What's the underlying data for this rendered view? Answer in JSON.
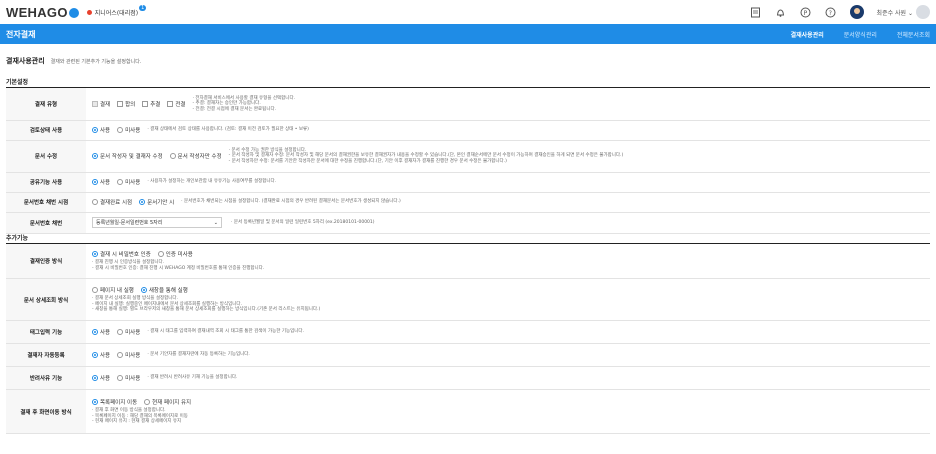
{
  "app": {
    "logo_text": "WEHAGO",
    "org_name": "지니어스(대리점)",
    "org_badge": "1",
    "user_name": "최준수 사원 ⌄"
  },
  "icons": {
    "top": [
      "document-icon",
      "bell-icon",
      "p-circle-icon",
      "help-icon"
    ]
  },
  "nav": {
    "title": "전자결재",
    "menu": [
      "결재사용관리",
      "문서양식관리",
      "전체문서조회"
    ]
  },
  "page": {
    "title": "결재사용관리",
    "desc": "결재와 관련된 기본추가 기능을 설정합니다."
  },
  "sections": {
    "basic": "기본설정",
    "extra": "추가기능"
  },
  "rows": {
    "type": {
      "label": "결재 유형",
      "opts": [
        "결재",
        "합의",
        "추결",
        "전결"
      ],
      "notes": [
        "· 전자결재 서비스에서 사용할 결재 유형을 선택합니다.",
        "  - 추결: 결재자는 승인만 가능합니다.",
        "  - 전결: 전결 시점에 결재 문서는 완료됩니다."
      ]
    },
    "review": {
      "label": "검토상태 사용",
      "opts": [
        "사용",
        "미사용"
      ],
      "note": "· 결재 상태에서 검토 상태를 사용합니다. (검토: 결재 이전 검토가 필요한 상태 • 보류)"
    },
    "modify": {
      "label": "문서 수정",
      "opts": [
        "문서 작성자 및 결재자 수정",
        "문서 작성자만 수정"
      ],
      "notes": [
        "· 문서 수정 가능 권한 방식을 설정합니다.",
        "  - 문서 작성자 및 결재자 수정: 문서 작성자 및 해당 문서의 결재권한을 보유한 결재권자가 내용을 수정할 수 있습니다.(단, 본인 결재순서에만 문서 수정이 가능하며 결재승인을 하게 되면 문서 수정은 불가합니다.)",
        "  - 문서 작성자만 수정: 문서를 기안한 작성자만 문서에 대한 수정을 진행합니다.(단, 기안 이후 결재자가 결재를 진행한 경우 문서 수정은 불가합니다.)"
      ]
    },
    "share": {
      "label": "공유기능 사용",
      "opts": [
        "사용",
        "미사용"
      ],
      "note": "· 사용자가 설정하는 개인보관함 내 유유기능 사용여부를 설정합니다."
    },
    "numtime": {
      "label": "문서번호 채번 시점",
      "opts": [
        "결재완료 시점",
        "문서기안 시"
      ],
      "note": "· 문서번호가 채번되는 시점을 설정합니다. (결재완료 시점의 경우 반려된 결재문서는 문서번호가 생성되지 않습니다.)"
    },
    "numrule": {
      "label": "문서번호 채번",
      "select": "등록년월일-문서일련번호 5자리",
      "note": "· 문서 등록년월일 및 문서의 일련 일련번호 5자리 (ex.20180101-00001)"
    },
    "auth": {
      "label": "결재인증 방식",
      "opts": [
        "결재 시 비밀번호 인증",
        "인증 미사용"
      ],
      "notes": [
        "· 결재 진행 시 인증방식을 설정합니다.",
        "  - 결재 시 비밀번호 인증: 결재 진행 시 WEHAGO 계정 비밀번호를 통해 인증을 진행합니다."
      ]
    },
    "detail": {
      "label": "문서 상세조회 방식",
      "opts": [
        "페이지 내 실행",
        "새창을 통해 실행"
      ],
      "notes": [
        "· 결재 문서 상세조회 실행 방식을 설정합니다.",
        "  - 페이지 내 실행: 실행중인 페이지내에서 문서 상세조회를 실행하는 방식입니다.",
        "  - 새창을 통해 실행: 별도 브라우저의 새창을 통해 문서 상세조회를 실행하는 방식입니다.(기존 문서 리스트는 유지됩니다.)"
      ]
    },
    "tag": {
      "label": "태그입력 기능",
      "opts": [
        "사용",
        "미사용"
      ],
      "note": "· 결재 시 태그를 입력하여 결재내역 조회 시 태그를 통한 검색이 가능한 기능입니다."
    },
    "auto": {
      "label": "결재자 자동등록",
      "opts": [
        "사용",
        "미사용"
      ],
      "note": "· 문서 기안자를 결재자란에 자동 등록하는 기능입니다."
    },
    "reject": {
      "label": "반려사유 기능",
      "opts": [
        "사용",
        "미사용"
      ],
      "note": "· 결재 반려시 반려사유 기재 기능을 설정합니다."
    },
    "after": {
      "label": "결재 후 화면이동 방식",
      "opts": [
        "목록페이지 이동",
        "현재 페이지 유지"
      ],
      "notes": [
        "· 결재 후 화면 이동 방식을 설정합니다.",
        "  - 목록페이지 이동 : 해당 결재의 목록페이지로 이동",
        "  - 현재 페이지 유지 : 현재 결재 상세페이지 유지"
      ]
    }
  }
}
